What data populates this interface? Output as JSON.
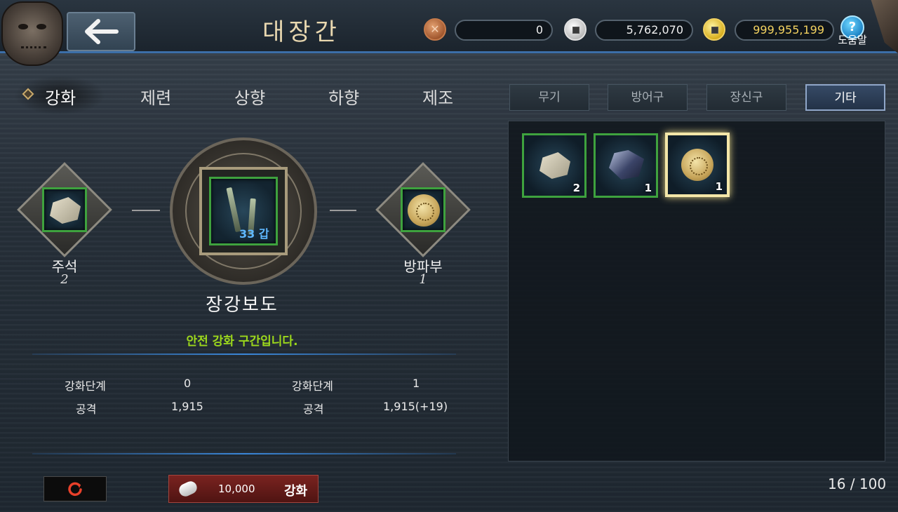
{
  "header": {
    "title": "대장간",
    "currencies": {
      "copper": "0",
      "silver": "5,762,070",
      "gold": "999,955,199"
    },
    "help_label": "도움말",
    "help_glyph": "?"
  },
  "tabs": [
    {
      "label": "강화",
      "active": true
    },
    {
      "label": "제련",
      "active": false
    },
    {
      "label": "상향",
      "active": false
    },
    {
      "label": "하향",
      "active": false
    },
    {
      "label": "제조",
      "active": false
    }
  ],
  "enhance": {
    "material_left": {
      "name": "주석",
      "count": "2",
      "icon": "stone-icon"
    },
    "target_item": {
      "name": "장강보도",
      "level": "33 갑",
      "icon": "sword-icon"
    },
    "material_right": {
      "name": "방파부",
      "count": "1",
      "icon": "charm-icon"
    },
    "safe_message": "안전 강화 구간입니다."
  },
  "stats": {
    "current": {
      "stage_label": "강화단계",
      "stage_value": "0",
      "attack_label": "공격",
      "attack_value": "1,915"
    },
    "next": {
      "stage_label": "강화단계",
      "stage_value": "1",
      "attack_label": "공격",
      "attack_value": "1,915(+19)"
    }
  },
  "actions": {
    "enhance_cost": "10,000",
    "enhance_label": "강화"
  },
  "inventory": {
    "categories": [
      {
        "label": "무기",
        "active": false
      },
      {
        "label": "방어구",
        "active": false
      },
      {
        "label": "장신구",
        "active": false
      },
      {
        "label": "기타",
        "active": true
      }
    ],
    "items": [
      {
        "icon": "stone-icon",
        "count": "2",
        "selected": false
      },
      {
        "icon": "ore-icon",
        "count": "1",
        "selected": false
      },
      {
        "icon": "charm-icon",
        "count": "1",
        "selected": true
      }
    ],
    "capacity": "16 / 100"
  },
  "colors": {
    "accent_blue": "#3a86d8",
    "slot_green": "#3ea23e",
    "safe_green": "#9cd81c",
    "gold_text": "#f3d260",
    "enhance_red": "#7a2320"
  }
}
